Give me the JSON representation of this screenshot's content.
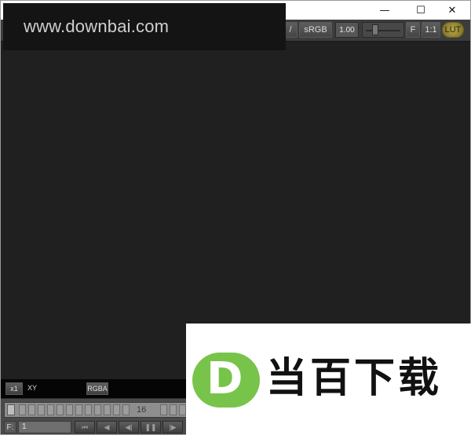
{
  "window_controls": {
    "minimize": "—",
    "maximize": "☐",
    "close": "✕"
  },
  "toolbar": {
    "partial_btn": "/",
    "colorspace": "sRGB",
    "gain": "1.00",
    "f_btn": "F",
    "ratio": "1:1",
    "lut": "LUT"
  },
  "watermark": {
    "text": "www.downbai.com"
  },
  "infobar": {
    "zoom": "x1",
    "coords": "XY",
    "channels": "RGBA"
  },
  "timeline": {
    "current_frame_label": "16"
  },
  "frame_row": {
    "label": "F:",
    "value": "1"
  },
  "playback": {
    "first": "⏮",
    "prev": "◀",
    "step_back": "◀|",
    "pause": "❚❚",
    "step_fwd": "|▶"
  },
  "ad": {
    "logo_letter": "D",
    "text": "当百下载"
  }
}
